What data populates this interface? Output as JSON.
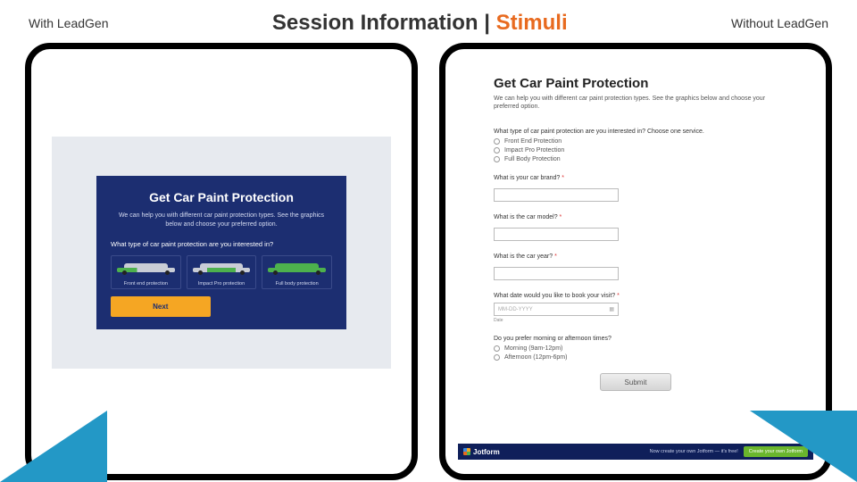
{
  "header": {
    "left_label": "With LeadGen",
    "title_main": "Session Information",
    "title_sep": " | ",
    "title_accent": "Stimuli",
    "right_label": "Without LeadGen"
  },
  "leadgen": {
    "title": "Get Car Paint Protection",
    "subtitle": "We can help you with different car paint protection types. See the graphics below and choose your preferred option.",
    "question": "What type of car paint protection are you interested in?",
    "options": [
      {
        "label": "Front end protection"
      },
      {
        "label": "Impact Pro protection"
      },
      {
        "label": "Full body protection"
      }
    ],
    "next_label": "Next"
  },
  "jotform": {
    "title": "Get Car Paint Protection",
    "subtitle": "We can help you with different car paint protection types. See the graphics below and choose your preferred option.",
    "q1": {
      "label": "What type of car paint protection are you interested in? Choose one service.",
      "options": [
        "Front End Protection",
        "Impact Pro Protection",
        "Full Body Protection"
      ]
    },
    "q2": {
      "label": "What is your car brand?"
    },
    "q3": {
      "label": "What is the car model?"
    },
    "q4": {
      "label": "What is the car year?"
    },
    "q5": {
      "label": "What date would you like to book your visit?",
      "placeholder": "MM-DD-YYYY",
      "hint": "Date"
    },
    "q6": {
      "label": "Do you prefer morning or afternoon times?",
      "options": [
        "Morning (9am-12pm)",
        "Afternoon (12pm-6pm)"
      ]
    },
    "submit": "Submit",
    "footer": {
      "brand": "Jotform",
      "tag": "Now create your own Jotform — it's free!",
      "cta": "Create your own Jotform"
    }
  }
}
